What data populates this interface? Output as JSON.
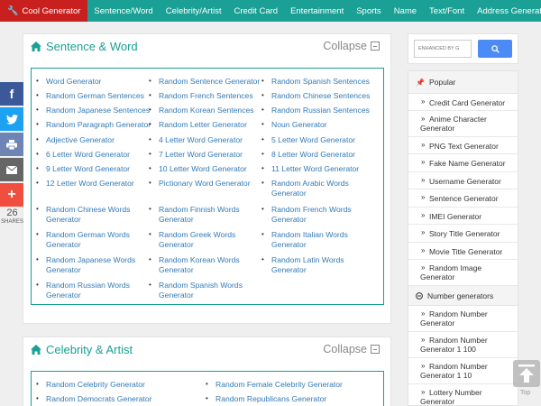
{
  "nav": {
    "items": [
      "Cool Generator",
      "Sentence/Word",
      "Celebrity/Artist",
      "Credit Card",
      "Entertainment",
      "Sports",
      "Name",
      "Text/Font",
      "Address Generator"
    ]
  },
  "sections": [
    {
      "title": "Sentence & Word",
      "collapse_label": "Collapse",
      "columns": [
        [
          "Word Generator",
          "Random German Sentences",
          "Random Japanese Sentences",
          "Random Paragraph Generator",
          "Adjective Generator",
          "6 Letter Word Generator",
          "9 Letter Word Generator",
          "12 Letter Word Generator",
          "Random Chinese Words Generator",
          "Random German Words Generator",
          "Random Japanese Words Generator",
          "Random Russian Words Generator"
        ],
        [
          "Random Sentence Generator",
          "Random French Sentences",
          "Random Korean Sentences",
          "Random Letter Generator",
          "4 Letter Word Generator",
          "7 Letter Word Generator",
          "10 Letter Word Generator",
          "Pictionary Word Generator",
          "Random Finnish Words Generator",
          "Random Greek Words Generator",
          "Random Korean Words Generator",
          "Random Spanish Words Generator"
        ],
        [
          "Random Spanish Sentences",
          "Random Chinese Sentences",
          "Random Russian Sentences",
          "Noun Generator",
          "5 Letter Word Generator",
          "8 Letter Word Generator",
          "11 Letter Word Generator",
          "Random Arabic Words Generator",
          "Random French Words Generator",
          "Random Italian Words Generator",
          "Random Latin Words Generator"
        ]
      ]
    },
    {
      "title": "Celebrity & Artist",
      "collapse_label": "Collapse",
      "columns": [
        [
          "Random Celebrity Generator",
          "Random Democrats Generator"
        ],
        [
          "Random Female Celebrity Generator",
          "Random Republicans Generator"
        ]
      ]
    }
  ],
  "search": {
    "placeholder": "ENHANCED BY G"
  },
  "sidebar": {
    "popular_title": "Popular",
    "popular_items": [
      "Credit Card Generator",
      "Anime Character Generator",
      "PNG Text Generator",
      "Fake Name Generator",
      "Username Generator",
      "Sentence Generator",
      "IMEI Generator",
      "Story Title Generator",
      "Movie Title Generator",
      "Random Image Generator"
    ],
    "number_title": "Number generators",
    "number_items": [
      "Random Number Generator",
      "Random Number Generator 1 100",
      "Random Number Generator 1 10",
      "Lottery Number Generator"
    ]
  },
  "share": {
    "count": "26",
    "label": "SHARES",
    "colors": {
      "facebook": "#3b5998",
      "twitter": "#1da1f2",
      "print": "#6d84b4",
      "email": "#666666",
      "more": "#f04e3e"
    }
  },
  "back_to_top": {
    "label": "Top"
  },
  "colors": {
    "nav_bg": "#1aa094",
    "active_tab": "#c8201e",
    "accent": "#1aa094",
    "link": "#337ab7"
  }
}
